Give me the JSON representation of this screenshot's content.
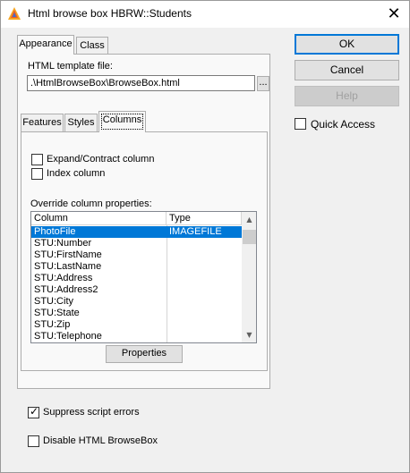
{
  "window": {
    "title": "Html browse box HBRW::Students",
    "close_glyph": "✕"
  },
  "tabs_outer": [
    {
      "label": "Appearance",
      "active": true
    },
    {
      "label": "Class",
      "active": false
    }
  ],
  "template": {
    "label": "HTML template file:",
    "value": ".\\HtmlBrowseBox\\BrowseBox.html",
    "browse_label": "..."
  },
  "tabs_inner": [
    {
      "label": "Features",
      "active": false
    },
    {
      "label": "Styles",
      "active": false
    },
    {
      "label": "Columns",
      "active": true
    }
  ],
  "columns_tab": {
    "expand_label": "Expand/Contract column",
    "expand_checked": false,
    "index_label": "Index column",
    "index_checked": false,
    "override_label": "Override column properties:",
    "list_headers": [
      "Column",
      "Type"
    ],
    "rows": [
      {
        "column": "PhotoFile",
        "type": "IMAGEFILE",
        "selected": true
      },
      {
        "column": "STU:Number",
        "type": ""
      },
      {
        "column": "STU:FirstName",
        "type": ""
      },
      {
        "column": "STU:LastName",
        "type": ""
      },
      {
        "column": "STU:Address",
        "type": ""
      },
      {
        "column": "STU:Address2",
        "type": ""
      },
      {
        "column": "STU:City",
        "type": ""
      },
      {
        "column": "STU:State",
        "type": ""
      },
      {
        "column": "STU:Zip",
        "type": ""
      },
      {
        "column": "STU:Telephone",
        "type": ""
      }
    ],
    "properties_button": "Properties"
  },
  "suppress": {
    "label": "Suppress script errors",
    "checked": true
  },
  "disable": {
    "label": "Disable HTML BrowseBox",
    "checked": false
  },
  "buttons": {
    "ok": "OK",
    "cancel": "Cancel",
    "help": "Help"
  },
  "quick_access": {
    "label": "Quick Access",
    "checked": false
  },
  "colors": {
    "accent": "#0078d7",
    "selection": "#0078d7",
    "background": "#f0f0f0"
  }
}
